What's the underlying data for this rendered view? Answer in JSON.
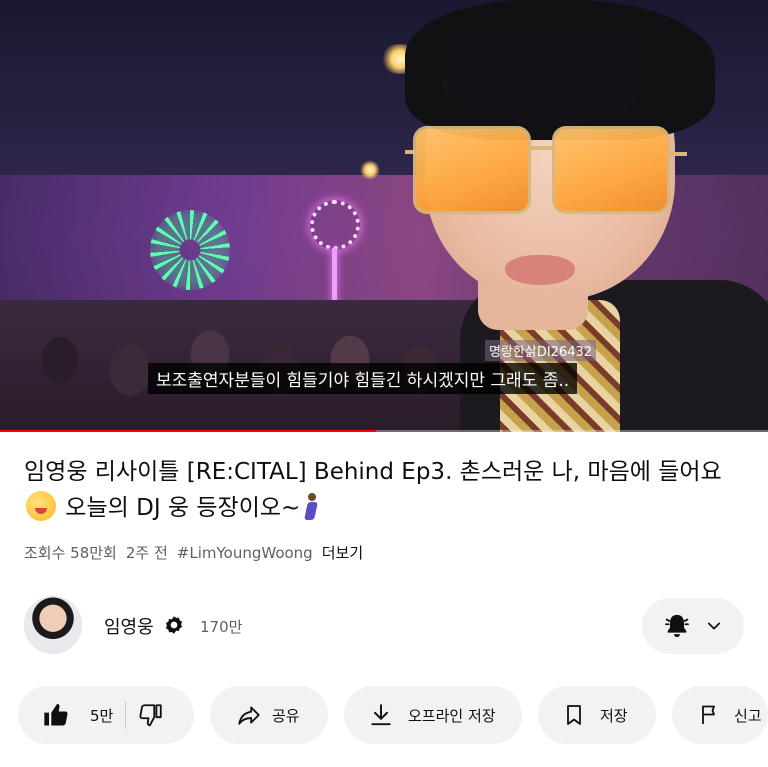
{
  "video": {
    "watermark": "명랑한삵DI26432",
    "subtitle": "보조출연자분들이 힘들기야 힘들긴 하시겠지만 그래도 좀..",
    "progress": 0.49
  },
  "info": {
    "title_part1": "임영웅 리사이틀 [RE:CITAL] Behind Ep3. 촌스러운 나, 마음에 들어요",
    "title_part2": " 오늘의 DJ 웅 등장이오~",
    "views": "조회수 58만회",
    "age": "2주 전",
    "hashtag": "#LimYoungWoong",
    "more_label": "더보기"
  },
  "channel": {
    "name": "임영웅",
    "subscribers": "170만",
    "notification_icon": "bell-icon",
    "dropdown_icon": "chevron-down-icon"
  },
  "actions": {
    "like_count": "5만",
    "share_label": "공유",
    "offline_label": "오프라인 저장",
    "save_label": "저장",
    "report_label": "신고"
  },
  "colors": {
    "progress": "#ff0000",
    "chip_bg": "#f2f2f2",
    "secondary_text": "#606060"
  }
}
